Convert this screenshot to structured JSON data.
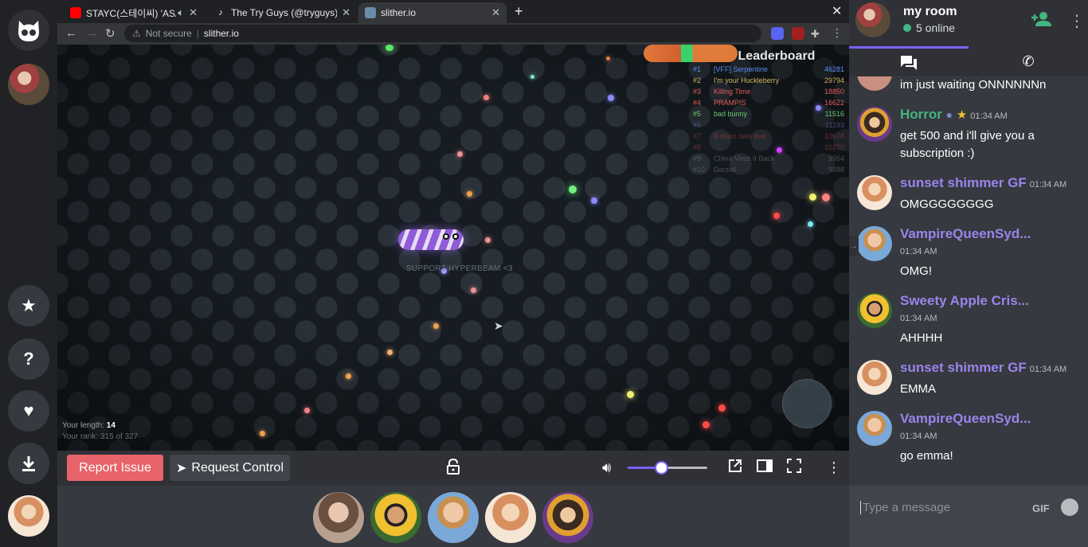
{
  "browser": {
    "tabs": [
      {
        "title": "STAYC(스테이씨) 'ASAP",
        "favicon_color": "#ff0000",
        "active": false
      },
      {
        "title": "The Try Guys (@tryguys)",
        "favicon_color": "#ffffff",
        "active": false
      },
      {
        "title": "slither.io",
        "favicon_color": "#6a8caa",
        "active": true
      }
    ],
    "security_label": "Not secure",
    "url": "slither.io"
  },
  "game": {
    "leaderboard_title": "Leaderboard",
    "leaderboard": [
      {
        "rank": "#1",
        "name": "[VFF] Serpentine",
        "score": "46281",
        "color": "#5b8ef0"
      },
      {
        "rank": "#2",
        "name": "I'm your Huckleberry",
        "score": "29794",
        "color": "#d0b860"
      },
      {
        "rank": "#3",
        "name": "Killing Time",
        "score": "18850",
        "color": "#e05a5a"
      },
      {
        "rank": "#4",
        "name": "PRAMPIS",
        "score": "16622",
        "color": "#e05a5a"
      },
      {
        "rank": "#5",
        "name": "bad bunny",
        "score": "11516",
        "color": "#68c86a"
      },
      {
        "rank": "#6",
        "name": "",
        "score": "11193",
        "color": "#7070c0"
      },
      {
        "rank": "#7",
        "name": "B team take that",
        "score": "10678",
        "color": "#b04040"
      },
      {
        "rank": "#8",
        "name": "",
        "score": "10270",
        "color": "#b04040"
      },
      {
        "rank": "#9",
        "name": "China Virus It Back",
        "score": "9954",
        "color": "#7a7a7a"
      },
      {
        "rank": "#10",
        "name": "Darziel",
        "score": "9888",
        "color": "#7a7a7a"
      }
    ],
    "player_label": "SUPPORT HYPERBEAM <3",
    "length_label": "Your length:",
    "length_value": "14",
    "rank_text": "Your rank: 315 of 327"
  },
  "controls": {
    "report_label": "Report Issue",
    "request_label": "Request Control",
    "volume": 0.42,
    "accent": "#7b61ff"
  },
  "chat": {
    "room_name": "my room",
    "online": "5 online",
    "messages": [
      {
        "name": "",
        "time": "",
        "text": "im just waiting ONNNNNNn",
        "name_color": "#ffffff"
      },
      {
        "name": "Horror",
        "time": "01:34 AM",
        "text": "get 500 and i'll give you a subscription :)",
        "name_color": "#43b581"
      },
      {
        "name": "sunset shimmer GF",
        "time": "01:34 AM",
        "text": "OMGGGGGGGG",
        "name_color": "#9b84ec"
      },
      {
        "name": "VampireQueenSyd...",
        "time": "01:34 AM",
        "text": "OMG!",
        "name_color": "#9b84ec"
      },
      {
        "name": "Sweety Apple Cris...",
        "time": "01:34 AM",
        "text": "AHHHH",
        "name_color": "#9b84ec"
      },
      {
        "name": "sunset shimmer GF",
        "time": "01:34 AM",
        "text": "EMMA",
        "name_color": "#9b84ec"
      },
      {
        "name": "VampireQueenSyd...",
        "time": "01:34 AM",
        "text": "go emma!",
        "name_color": "#9b84ec"
      }
    ],
    "input_placeholder": "Type a message",
    "gif_label": "GIF"
  }
}
